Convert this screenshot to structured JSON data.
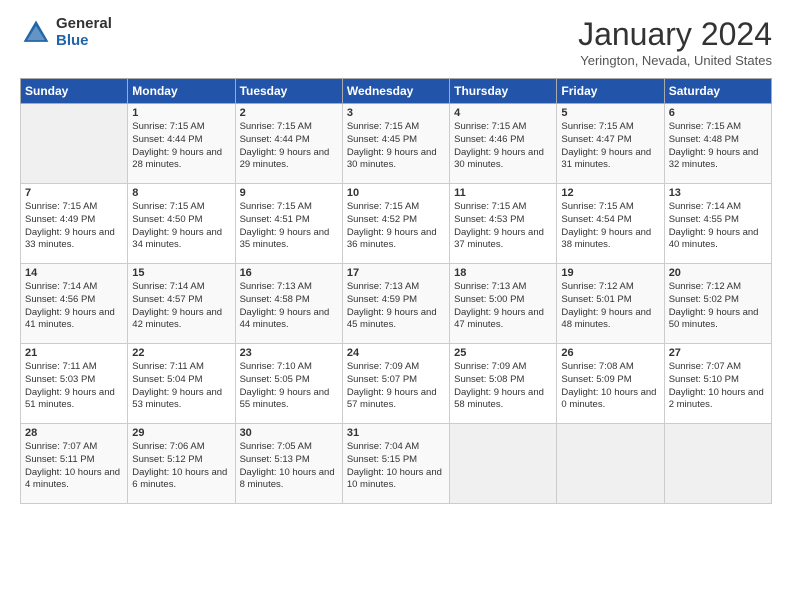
{
  "header": {
    "logo_general": "General",
    "logo_blue": "Blue",
    "title": "January 2024",
    "subtitle": "Yerington, Nevada, United States"
  },
  "days_of_week": [
    "Sunday",
    "Monday",
    "Tuesday",
    "Wednesday",
    "Thursday",
    "Friday",
    "Saturday"
  ],
  "weeks": [
    [
      {
        "num": "",
        "sunrise": "",
        "sunset": "",
        "daylight": "",
        "empty": true
      },
      {
        "num": "1",
        "sunrise": "Sunrise: 7:15 AM",
        "sunset": "Sunset: 4:44 PM",
        "daylight": "Daylight: 9 hours and 28 minutes."
      },
      {
        "num": "2",
        "sunrise": "Sunrise: 7:15 AM",
        "sunset": "Sunset: 4:44 PM",
        "daylight": "Daylight: 9 hours and 29 minutes."
      },
      {
        "num": "3",
        "sunrise": "Sunrise: 7:15 AM",
        "sunset": "Sunset: 4:45 PM",
        "daylight": "Daylight: 9 hours and 30 minutes."
      },
      {
        "num": "4",
        "sunrise": "Sunrise: 7:15 AM",
        "sunset": "Sunset: 4:46 PM",
        "daylight": "Daylight: 9 hours and 30 minutes."
      },
      {
        "num": "5",
        "sunrise": "Sunrise: 7:15 AM",
        "sunset": "Sunset: 4:47 PM",
        "daylight": "Daylight: 9 hours and 31 minutes."
      },
      {
        "num": "6",
        "sunrise": "Sunrise: 7:15 AM",
        "sunset": "Sunset: 4:48 PM",
        "daylight": "Daylight: 9 hours and 32 minutes."
      }
    ],
    [
      {
        "num": "7",
        "sunrise": "Sunrise: 7:15 AM",
        "sunset": "Sunset: 4:49 PM",
        "daylight": "Daylight: 9 hours and 33 minutes."
      },
      {
        "num": "8",
        "sunrise": "Sunrise: 7:15 AM",
        "sunset": "Sunset: 4:50 PM",
        "daylight": "Daylight: 9 hours and 34 minutes."
      },
      {
        "num": "9",
        "sunrise": "Sunrise: 7:15 AM",
        "sunset": "Sunset: 4:51 PM",
        "daylight": "Daylight: 9 hours and 35 minutes."
      },
      {
        "num": "10",
        "sunrise": "Sunrise: 7:15 AM",
        "sunset": "Sunset: 4:52 PM",
        "daylight": "Daylight: 9 hours and 36 minutes."
      },
      {
        "num": "11",
        "sunrise": "Sunrise: 7:15 AM",
        "sunset": "Sunset: 4:53 PM",
        "daylight": "Daylight: 9 hours and 37 minutes."
      },
      {
        "num": "12",
        "sunrise": "Sunrise: 7:15 AM",
        "sunset": "Sunset: 4:54 PM",
        "daylight": "Daylight: 9 hours and 38 minutes."
      },
      {
        "num": "13",
        "sunrise": "Sunrise: 7:14 AM",
        "sunset": "Sunset: 4:55 PM",
        "daylight": "Daylight: 9 hours and 40 minutes."
      }
    ],
    [
      {
        "num": "14",
        "sunrise": "Sunrise: 7:14 AM",
        "sunset": "Sunset: 4:56 PM",
        "daylight": "Daylight: 9 hours and 41 minutes."
      },
      {
        "num": "15",
        "sunrise": "Sunrise: 7:14 AM",
        "sunset": "Sunset: 4:57 PM",
        "daylight": "Daylight: 9 hours and 42 minutes."
      },
      {
        "num": "16",
        "sunrise": "Sunrise: 7:13 AM",
        "sunset": "Sunset: 4:58 PM",
        "daylight": "Daylight: 9 hours and 44 minutes."
      },
      {
        "num": "17",
        "sunrise": "Sunrise: 7:13 AM",
        "sunset": "Sunset: 4:59 PM",
        "daylight": "Daylight: 9 hours and 45 minutes."
      },
      {
        "num": "18",
        "sunrise": "Sunrise: 7:13 AM",
        "sunset": "Sunset: 5:00 PM",
        "daylight": "Daylight: 9 hours and 47 minutes."
      },
      {
        "num": "19",
        "sunrise": "Sunrise: 7:12 AM",
        "sunset": "Sunset: 5:01 PM",
        "daylight": "Daylight: 9 hours and 48 minutes."
      },
      {
        "num": "20",
        "sunrise": "Sunrise: 7:12 AM",
        "sunset": "Sunset: 5:02 PM",
        "daylight": "Daylight: 9 hours and 50 minutes."
      }
    ],
    [
      {
        "num": "21",
        "sunrise": "Sunrise: 7:11 AM",
        "sunset": "Sunset: 5:03 PM",
        "daylight": "Daylight: 9 hours and 51 minutes."
      },
      {
        "num": "22",
        "sunrise": "Sunrise: 7:11 AM",
        "sunset": "Sunset: 5:04 PM",
        "daylight": "Daylight: 9 hours and 53 minutes."
      },
      {
        "num": "23",
        "sunrise": "Sunrise: 7:10 AM",
        "sunset": "Sunset: 5:05 PM",
        "daylight": "Daylight: 9 hours and 55 minutes."
      },
      {
        "num": "24",
        "sunrise": "Sunrise: 7:09 AM",
        "sunset": "Sunset: 5:07 PM",
        "daylight": "Daylight: 9 hours and 57 minutes."
      },
      {
        "num": "25",
        "sunrise": "Sunrise: 7:09 AM",
        "sunset": "Sunset: 5:08 PM",
        "daylight": "Daylight: 9 hours and 58 minutes."
      },
      {
        "num": "26",
        "sunrise": "Sunrise: 7:08 AM",
        "sunset": "Sunset: 5:09 PM",
        "daylight": "Daylight: 10 hours and 0 minutes."
      },
      {
        "num": "27",
        "sunrise": "Sunrise: 7:07 AM",
        "sunset": "Sunset: 5:10 PM",
        "daylight": "Daylight: 10 hours and 2 minutes."
      }
    ],
    [
      {
        "num": "28",
        "sunrise": "Sunrise: 7:07 AM",
        "sunset": "Sunset: 5:11 PM",
        "daylight": "Daylight: 10 hours and 4 minutes."
      },
      {
        "num": "29",
        "sunrise": "Sunrise: 7:06 AM",
        "sunset": "Sunset: 5:12 PM",
        "daylight": "Daylight: 10 hours and 6 minutes."
      },
      {
        "num": "30",
        "sunrise": "Sunrise: 7:05 AM",
        "sunset": "Sunset: 5:13 PM",
        "daylight": "Daylight: 10 hours and 8 minutes."
      },
      {
        "num": "31",
        "sunrise": "Sunrise: 7:04 AM",
        "sunset": "Sunset: 5:15 PM",
        "daylight": "Daylight: 10 hours and 10 minutes."
      },
      {
        "num": "",
        "sunrise": "",
        "sunset": "",
        "daylight": "",
        "empty": true
      },
      {
        "num": "",
        "sunrise": "",
        "sunset": "",
        "daylight": "",
        "empty": true
      },
      {
        "num": "",
        "sunrise": "",
        "sunset": "",
        "daylight": "",
        "empty": true
      }
    ]
  ]
}
